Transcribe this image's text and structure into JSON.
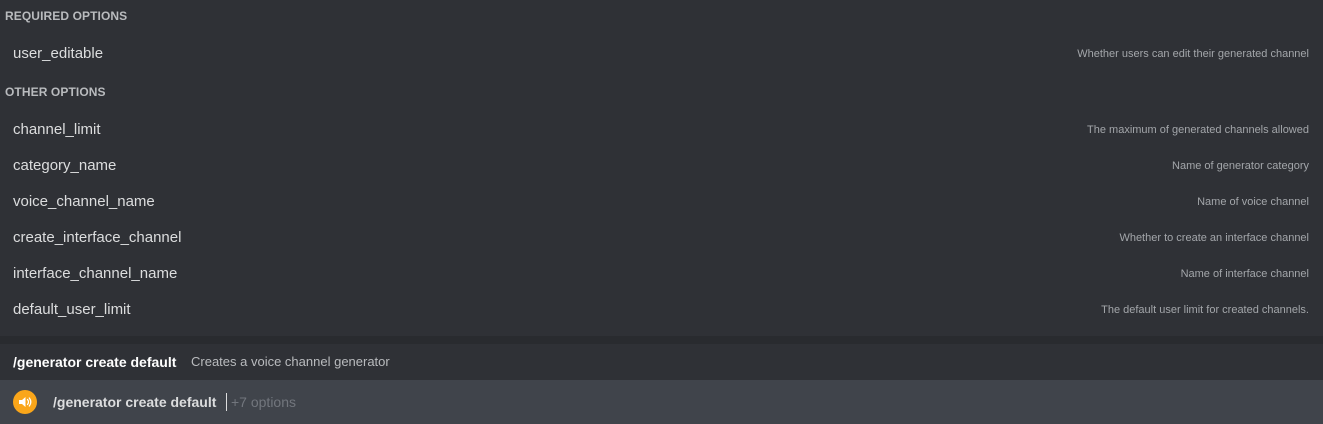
{
  "required_section": {
    "header": "REQUIRED OPTIONS",
    "options": [
      {
        "name": "user_editable",
        "description": "Whether users can edit their generated channel"
      }
    ]
  },
  "other_section": {
    "header": "OTHER OPTIONS",
    "options": [
      {
        "name": "channel_limit",
        "description": "The maximum of generated channels allowed"
      },
      {
        "name": "category_name",
        "description": "Name of generator category"
      },
      {
        "name": "voice_channel_name",
        "description": "Name of voice channel"
      },
      {
        "name": "create_interface_channel",
        "description": "Whether to create an interface channel"
      },
      {
        "name": "interface_channel_name",
        "description": "Name of interface channel"
      },
      {
        "name": "default_user_limit",
        "description": "The default user limit for created channels."
      }
    ]
  },
  "command": {
    "name": "/generator create default",
    "description": "Creates a voice channel generator"
  },
  "input": {
    "command_text": "/generator create default",
    "hint": "+7 options",
    "icon": "speaker-icon"
  },
  "colors": {
    "panel_bg": "#2f3136",
    "input_bg": "#40444b",
    "icon_accent": "#faa61a"
  }
}
